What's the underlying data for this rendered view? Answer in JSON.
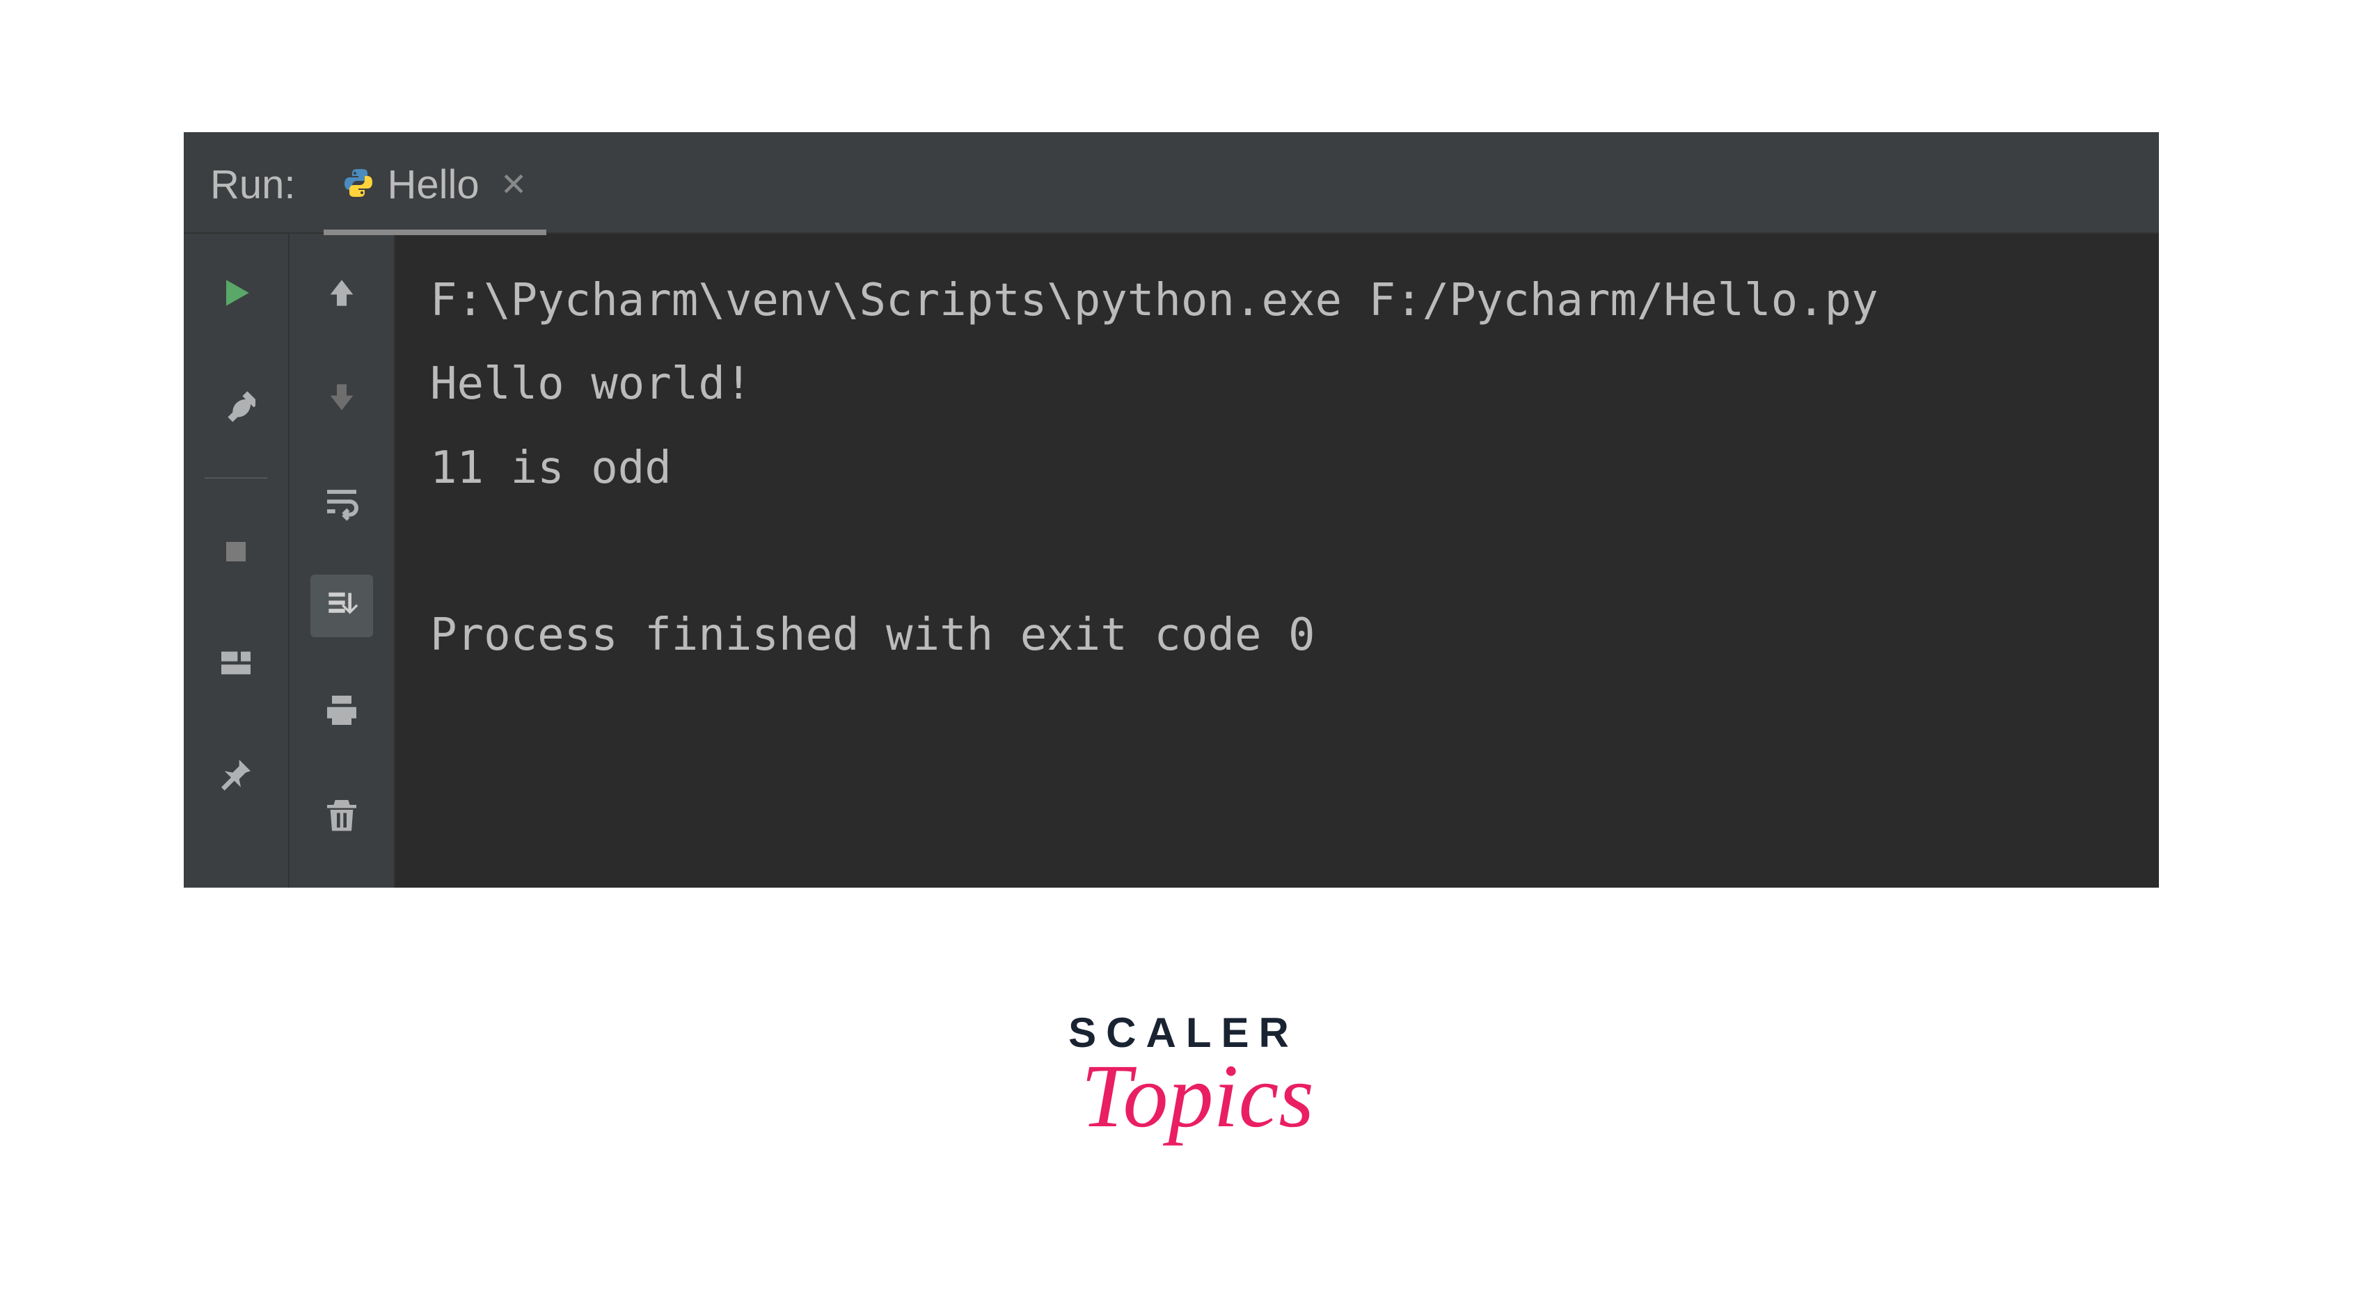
{
  "header": {
    "run_label": "Run:",
    "tab_label": "Hello"
  },
  "console": {
    "lines": [
      "F:\\Pycharm\\venv\\Scripts\\python.exe F:/Pycharm/Hello.py",
      "Hello world!",
      "11 is odd",
      "",
      "Process finished with exit code 0"
    ]
  },
  "watermark": {
    "main": "SCALER",
    "sub": "Topics"
  },
  "colors": {
    "run_green": "#59a869",
    "icon_gray": "#afb1b3",
    "pink": "#e91e63"
  }
}
